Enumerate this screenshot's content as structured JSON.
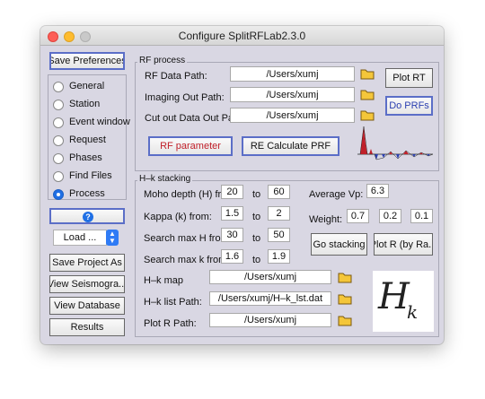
{
  "window": {
    "title": "Configure SplitRFLab2.3.0"
  },
  "sidebar": {
    "save_preferences": "Save Preferences",
    "options": [
      {
        "label": "General",
        "selected": false
      },
      {
        "label": "Station",
        "selected": false
      },
      {
        "label": "Event window",
        "selected": false
      },
      {
        "label": "Request",
        "selected": false
      },
      {
        "label": "Phases",
        "selected": false
      },
      {
        "label": "Find Files",
        "selected": false
      },
      {
        "label": "Process",
        "selected": true
      }
    ],
    "help_icon": "question-icon",
    "load_select": "Load ...",
    "buttons": {
      "save_project": "Save Project As",
      "view_seismograms": "View Seismogra...",
      "view_database": "View Database",
      "results": "Results"
    }
  },
  "rf_process": {
    "title": "RF process",
    "data_path": {
      "label": "RF Data Path:",
      "value": "/Users/xumj"
    },
    "imaging_out": {
      "label": "Imaging Out Path:",
      "value": "/Users/xumj"
    },
    "cutout_out": {
      "label": "Cut out Data Out Path:",
      "value": "/Users/xumj"
    },
    "plot_rt": "Plot RT",
    "do_prfs": "Do PRFs",
    "rf_parameter": "RF parameter",
    "re_calculate": "RE Calculate PRF",
    "colors": {
      "accent_red": "#c0202a",
      "accent_blue": "#2b3fb0"
    }
  },
  "hk": {
    "title": "H–k stacking",
    "moho": {
      "label": "Moho depth (H) from",
      "from": "20",
      "to_label": "to",
      "to": "60"
    },
    "kappa": {
      "label": "Kappa (k) from:",
      "from": "1.5",
      "to_label": "to",
      "to": "2"
    },
    "search_h": {
      "label": "Search max H from:",
      "from": "30",
      "to_label": "to",
      "to": "50"
    },
    "search_k": {
      "label": "Search max k from:",
      "from": "1.6",
      "to_label": "to",
      "to": "1.9"
    },
    "average_vp": {
      "label": "Average Vp:",
      "value": "6.3"
    },
    "weight": {
      "label": "Weight:",
      "values": [
        "0.7",
        "0.2",
        "0.1"
      ]
    },
    "go_stacking": "Go stacking",
    "plot_r": "Plot R (by Ra...",
    "hk_map": {
      "label": "H–k map",
      "value": "/Users/xumj"
    },
    "hk_list": {
      "label": "H–k list Path:",
      "value": "/Users/xumj/H–k_lst.dat"
    },
    "plot_r_path": {
      "label": "Plot R Path:",
      "value": "/Users/xumj"
    },
    "logo_H": "H",
    "logo_k": "k"
  }
}
